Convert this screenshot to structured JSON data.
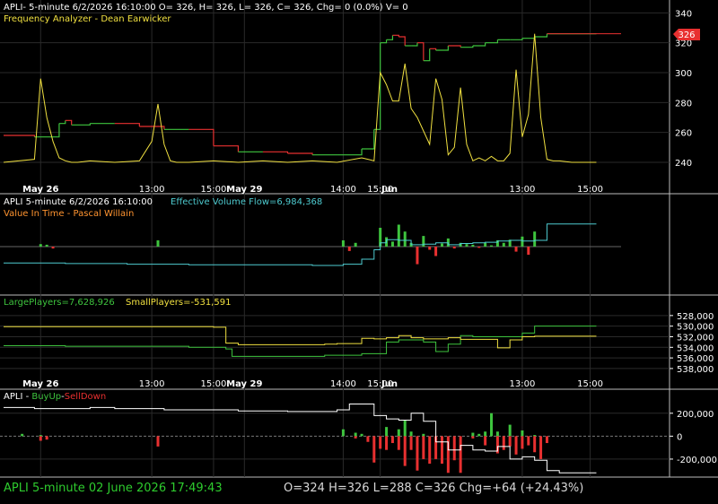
{
  "symbol": "APLI",
  "colors": {
    "background": "#000000",
    "grid": "#2a2a2a",
    "separator": "#bcbcbc",
    "text": "#ffffff",
    "yellow": "#f0e040",
    "orange": "#ff9430",
    "red": "#e83030",
    "green": "#3ec43e",
    "cyan": "#4ecbd0",
    "lime": "#9ae84a",
    "status_green": "#2ecc2e"
  },
  "panels": {
    "price": {
      "header": "APLI- 5-minute 6/2/2026 16:10:00 O= 326, H= 326, L= 326, C= 326, Chg= 0 (0.0%) V= 0",
      "subheader": "Frequency Analyzer - Dean Earwicker",
      "price_badge": "326",
      "x_ticks": [
        "May 26",
        "13:00",
        "15:00",
        "May 29",
        "14:00",
        "15:00",
        "Jun",
        "13:00",
        "15:00"
      ]
    },
    "vif": {
      "header_left": "APLI 5-minute  6/2/2026 16:10:00",
      "header_right": "Effective Volume Flow=6,984,368",
      "subheader": "Value In Time - Pascal Willain"
    },
    "players": {
      "large_label": "LargePlayers=7,628,926",
      "small_label": "SmallPlayers=-531,591",
      "x_ticks": [
        "May 26",
        "13:00",
        "15:00",
        "May 29",
        "14:00",
        "15:00",
        "Jun",
        "13:00",
        "15:00"
      ]
    },
    "buyup": {
      "title_prefix": "APLI - ",
      "title_buy": "BuyUp",
      "title_dash": "-",
      "title_sell": "SellDown"
    }
  },
  "status_bar": {
    "left": "APLI  5-minute   02 June 2026 17:49:43",
    "right": "O=324  H=326  L=288  C=326  Chg=+64 (+24.43%)"
  },
  "chart_data": [
    {
      "type": "line",
      "name": "price-panel",
      "y_axis": {
        "ticks": [
          240,
          260,
          280,
          300,
          320,
          340
        ],
        "range": [
          225,
          345
        ]
      },
      "x_range": [
        0,
        100
      ],
      "series": [
        {
          "name": "",
          "role": "price-close",
          "color": "#e83030",
          "x": [
            0,
            5,
            9,
            10,
            11,
            14,
            18,
            22,
            26,
            30,
            34,
            38,
            42,
            46,
            50,
            54,
            58,
            60,
            61,
            62,
            63,
            64,
            65,
            66,
            67,
            68,
            69,
            70,
            72,
            74,
            76,
            78,
            80,
            82,
            84,
            86,
            88,
            92,
            96
          ],
          "y": [
            258,
            257,
            266,
            268,
            265,
            266,
            266,
            264,
            262,
            262,
            251,
            247,
            247,
            246,
            245,
            245,
            249,
            262,
            320,
            322,
            325,
            324,
            318,
            318,
            320,
            308,
            316,
            315,
            318,
            317,
            318,
            320,
            322,
            322,
            323,
            324,
            326,
            326,
            326
          ]
        },
        {
          "name": "",
          "role": "frequency",
          "color": "#f0e040",
          "x": [
            0,
            5,
            6,
            7,
            8,
            9,
            10,
            11,
            12,
            14,
            18,
            22,
            24,
            25,
            26,
            27,
            28,
            30,
            34,
            38,
            42,
            46,
            50,
            54,
            58,
            59,
            60,
            61,
            62,
            63,
            64,
            65,
            66,
            67,
            68,
            69,
            70,
            71,
            72,
            73,
            74,
            75,
            76,
            77,
            78,
            79,
            80,
            81,
            82,
            83,
            84,
            85,
            86,
            87,
            88,
            89,
            90,
            92,
            96
          ],
          "y": [
            240,
            242,
            296,
            270,
            254,
            243,
            241,
            240,
            240,
            241,
            240,
            241,
            254,
            279,
            252,
            241,
            240,
            240,
            241,
            240,
            241,
            240,
            241,
            240,
            243,
            242,
            241,
            300,
            292,
            281,
            281,
            306,
            276,
            270,
            261,
            252,
            296,
            282,
            245,
            250,
            290,
            252,
            241,
            243,
            241,
            244,
            241,
            241,
            246,
            302,
            257,
            272,
            326,
            270,
            242,
            241,
            241,
            240,
            240
          ]
        }
      ]
    },
    {
      "type": "line",
      "name": "value-in-time-panel",
      "x_range": [
        0,
        100
      ],
      "series": [
        {
          "name": "",
          "role": "effective-volume-flow",
          "color": "#4ecbd0",
          "x": [
            0,
            5,
            10,
            20,
            30,
            40,
            50,
            55,
            58,
            60,
            61,
            62,
            64,
            66,
            68,
            70,
            72,
            74,
            76,
            78,
            80,
            82,
            84,
            86,
            88,
            92,
            96
          ],
          "y": [
            -2.6,
            -2.6,
            -2.7,
            -2.8,
            -2.9,
            -2.9,
            -3.0,
            -2.8,
            -2.0,
            -0.5,
            0.6,
            1.1,
            1.0,
            0.3,
            0.4,
            0.6,
            0.3,
            0.5,
            0.6,
            0.7,
            0.9,
            1.0,
            0.9,
            1.0,
            3.6,
            3.6,
            3.6
          ]
        },
        {
          "name": "",
          "role": "volume-bars",
          "color": "#3ec43e",
          "x": [
            6,
            7,
            8,
            25,
            55,
            56,
            57,
            61,
            62,
            63,
            64,
            65,
            66,
            67,
            68,
            69,
            70,
            71,
            72,
            73,
            74,
            75,
            76,
            77,
            78,
            79,
            80,
            81,
            82,
            83,
            84,
            85,
            86
          ],
          "y": [
            0.4,
            0.3,
            -0.3,
            1.0,
            1.0,
            -0.7,
            0.6,
            3.0,
            1.5,
            0.8,
            3.5,
            2.4,
            0.6,
            -2.8,
            1.7,
            -0.5,
            -1.5,
            0.5,
            1.3,
            -0.3,
            0.6,
            0.4,
            0.3,
            -0.2,
            0.6,
            0.2,
            1.0,
            0.6,
            1.1,
            -0.8,
            1.6,
            -1.3,
            2.4
          ]
        }
      ]
    },
    {
      "type": "line",
      "name": "players-panel",
      "y_axis": {
        "ticks": [
          528000,
          530000,
          532000,
          534000,
          536000,
          538000
        ],
        "range": [
          526500,
          539200
        ],
        "inverted": true
      },
      "x_range": [
        0,
        100
      ],
      "series": [
        {
          "name": "LargePlayers",
          "color": "#3ec43e",
          "x": [
            0,
            5,
            10,
            20,
            30,
            36,
            37,
            40,
            44,
            50,
            52,
            54,
            58,
            62,
            64,
            66,
            68,
            70,
            72,
            74,
            76,
            80,
            82,
            84,
            86,
            90,
            96
          ],
          "y": [
            533700,
            533700,
            533800,
            533800,
            534000,
            534300,
            535700,
            535700,
            535700,
            535700,
            535500,
            535500,
            535200,
            533000,
            532600,
            532600,
            533000,
            534800,
            533400,
            531800,
            532000,
            532000,
            532000,
            531300,
            530000,
            530000,
            530000
          ]
        },
        {
          "name": "SmallPlayers",
          "color": "#f0e040",
          "x": [
            0,
            5,
            10,
            20,
            30,
            34,
            36,
            38,
            44,
            50,
            52,
            54,
            58,
            60,
            62,
            64,
            66,
            68,
            70,
            72,
            74,
            76,
            78,
            80,
            82,
            84,
            86,
            90,
            96
          ],
          "y": [
            530100,
            530100,
            530100,
            530100,
            530100,
            530200,
            533200,
            533500,
            533500,
            533500,
            533400,
            533300,
            532300,
            532400,
            532200,
            531800,
            532200,
            532400,
            532400,
            532200,
            532500,
            532500,
            532500,
            534100,
            532600,
            532000,
            531900,
            531900,
            531900
          ]
        }
      ]
    },
    {
      "type": "bar",
      "name": "buyup-selldown-panel",
      "y_axis": {
        "ticks": [
          -200000,
          0,
          200000
        ],
        "range": [
          -310000,
          300000
        ]
      },
      "x_range": [
        0,
        100
      ],
      "series": [
        {
          "name": "BuyUp",
          "color": "#3ec43e",
          "x": [
            3,
            6,
            55,
            57,
            58,
            62,
            64,
            65,
            66,
            68,
            76,
            77,
            78,
            79,
            80,
            82,
            84,
            86
          ],
          "y": [
            20000,
            10000,
            60000,
            30000,
            20000,
            80000,
            60000,
            140000,
            40000,
            20000,
            30000,
            20000,
            40000,
            200000,
            40000,
            100000,
            50000,
            10000
          ]
        },
        {
          "name": "SellDown",
          "color": "#e83030",
          "x": [
            6,
            7,
            25,
            57,
            59,
            60,
            61,
            62,
            63,
            64,
            65,
            66,
            67,
            68,
            69,
            70,
            71,
            72,
            73,
            74,
            76,
            78,
            80,
            81,
            82,
            83,
            84,
            85,
            86,
            87,
            88
          ],
          "y": [
            -40000,
            -30000,
            -90000,
            -20000,
            -50000,
            -230000,
            -110000,
            -120000,
            -60000,
            -120000,
            -260000,
            -120000,
            -300000,
            -200000,
            -240000,
            -200000,
            -240000,
            -320000,
            -210000,
            -320000,
            -20000,
            -80000,
            -150000,
            -120000,
            -90000,
            -160000,
            -110000,
            -80000,
            -140000,
            -200000,
            -60000
          ]
        },
        {
          "name": "",
          "role": "cumulative",
          "color": "#ffffff",
          "x": [
            0,
            5,
            10,
            14,
            18,
            22,
            26,
            30,
            34,
            38,
            42,
            46,
            50,
            54,
            56,
            58,
            60,
            62,
            64,
            66,
            68,
            70,
            72,
            74,
            76,
            78,
            80,
            82,
            84,
            86,
            88,
            90,
            92,
            96
          ],
          "y": [
            250000,
            240000,
            240000,
            250000,
            240000,
            240000,
            230000,
            230000,
            230000,
            220000,
            220000,
            215000,
            215000,
            230000,
            280000,
            280000,
            180000,
            150000,
            140000,
            200000,
            130000,
            -50000,
            -120000,
            -80000,
            -120000,
            -130000,
            -90000,
            -200000,
            -180000,
            -210000,
            -300000,
            -320000,
            -320000,
            -320000
          ]
        }
      ]
    }
  ]
}
